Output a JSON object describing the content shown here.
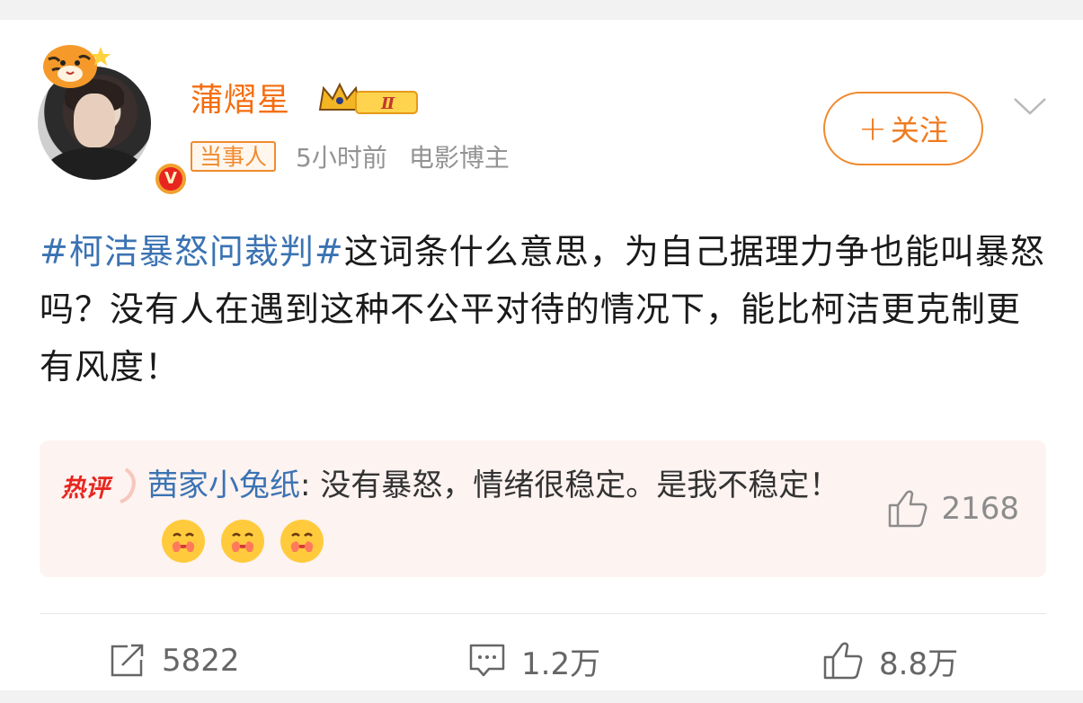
{
  "post": {
    "author": {
      "name": "蒲熠星",
      "level_badge": "Ⅱ",
      "tag": "当事人",
      "time": "5小时前",
      "source": "电影博主",
      "verified_icon": "v-verified-icon"
    },
    "follow_label": "关注",
    "follow_plus": "+",
    "text": {
      "hashtag": "#柯洁暴怒问裁判#",
      "body": "这词条什么意思，为自己据理力争也能叫暴怒吗？没有人在遇到这种不公平对待的情况下，能比柯洁更克制更有风度！"
    },
    "hot_comment": {
      "badge": "热评",
      "user": "茜家小兔纸",
      "separator": ": ",
      "text": "没有暴怒，情绪很稳定。是我不稳定！",
      "emoji_count": 3,
      "likes": "2168"
    },
    "actions": {
      "share": "5822",
      "comment": "1.2万",
      "like": "8.8万"
    }
  },
  "colors": {
    "name": "#f56e10",
    "hashtag": "#3b73b3",
    "accent": "#f08a2e",
    "hot_badge": "#e8251e"
  }
}
